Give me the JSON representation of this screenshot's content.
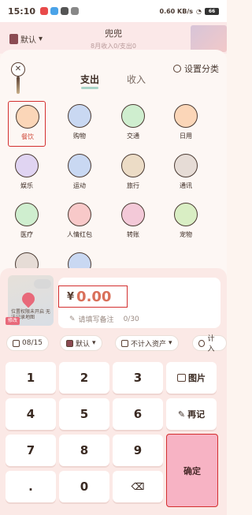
{
  "status_bar": {
    "time": "15:10",
    "net": "0.60 KB/s",
    "battery": "66"
  },
  "header": {
    "book": "默认",
    "title": "兜兜",
    "subtitle": "8月收入0/支出0"
  },
  "tabs": [
    {
      "label": "支出"
    },
    {
      "label": "收入"
    }
  ],
  "settings_label": "设置分类",
  "categories": [
    {
      "label": "餐饮",
      "icon": "bowl-icon",
      "color": "#fbd6b8"
    },
    {
      "label": "购物",
      "icon": "bag-icon",
      "color": "#c9d8f2"
    },
    {
      "label": "交通",
      "icon": "bus-icon",
      "color": "#cfeecf"
    },
    {
      "label": "日用",
      "icon": "tissue-icon",
      "color": "#fbd6b8"
    },
    {
      "label": "娱乐",
      "icon": "gamepad-icon",
      "color": "#e0d4f2"
    },
    {
      "label": "运动",
      "icon": "racket-icon",
      "color": "#c9d8f2"
    },
    {
      "label": "旅行",
      "icon": "signpost-icon",
      "color": "#ecdcc6"
    },
    {
      "label": "通讯",
      "icon": "phone-icon",
      "color": "#e6dcd6"
    },
    {
      "label": "医疗",
      "icon": "medkit-icon",
      "color": "#cfeecf"
    },
    {
      "label": "人情红包",
      "icon": "redpacket-icon",
      "color": "#f8c9c9"
    },
    {
      "label": "转账",
      "icon": "transfer-icon",
      "color": "#f3c9d8"
    },
    {
      "label": "宠物",
      "icon": "paw-icon",
      "color": "#d9eec4"
    },
    {
      "label": "",
      "icon": "bottle-icon",
      "color": "#e6dcd6"
    },
    {
      "label": "",
      "icon": "grid-icon",
      "color": "#c9d8f2"
    }
  ],
  "location": {
    "text": "位置权限未开启 无法记录地图",
    "badge": "修改"
  },
  "amount": {
    "currency": "¥",
    "value": "0.00"
  },
  "note": {
    "placeholder": "请填写备注",
    "count": "0/30"
  },
  "options": {
    "date": "08/15",
    "book": "默认",
    "asset": "不计入资产",
    "extra": "计入"
  },
  "keypad": {
    "keys": [
      "1",
      "2",
      "3",
      "4",
      "5",
      "6",
      "7",
      "8",
      "9",
      ".",
      "0"
    ],
    "picture": "图片",
    "again": "再记",
    "confirm": "确定"
  },
  "accent": "#f7b3c4"
}
